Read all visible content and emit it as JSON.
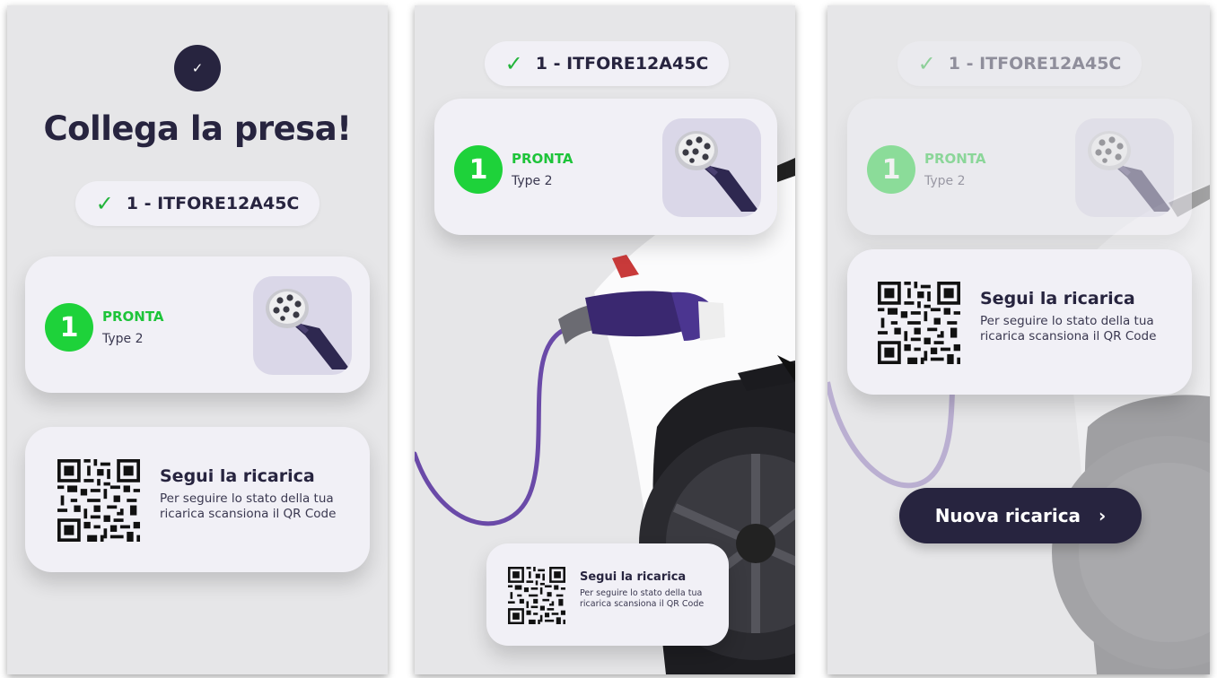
{
  "screen1": {
    "heading": "Collega la presa!",
    "station_id": "1 - ITFORE12A45C",
    "connector": {
      "number": "1",
      "status": "PRONTA",
      "type": "Type 2"
    },
    "qr": {
      "title": "Segui la ricarica",
      "description": "Per seguire lo stato della tua ricarica scansiona il QR Code"
    }
  },
  "screen2": {
    "station_id": "1 - ITFORE12A45C",
    "connector": {
      "number": "1",
      "status": "PRONTA",
      "type": "Type 2"
    },
    "qr": {
      "title": "Segui la ricarica",
      "description": "Per seguire lo stato della tua ricarica scansiona il QR Code"
    }
  },
  "screen3": {
    "station_id": "1 - ITFORE12A45C",
    "connector": {
      "number": "1",
      "status": "PRONTA",
      "type": "Type 2"
    },
    "qr": {
      "title": "Segui la ricarica",
      "description": "Per seguire lo stato della tua ricarica scansiona il QR Code"
    },
    "new_charge_button": "Nuova ricarica"
  },
  "colors": {
    "brand_dark": "#27243f",
    "ready_green": "#1ed23a",
    "card_bg": "#f1f0f6",
    "cable_purple": "#6a4aa8"
  },
  "icons": [
    "check-icon",
    "connector-type2-icon",
    "qr-code-icon",
    "chevron-right-icon"
  ]
}
